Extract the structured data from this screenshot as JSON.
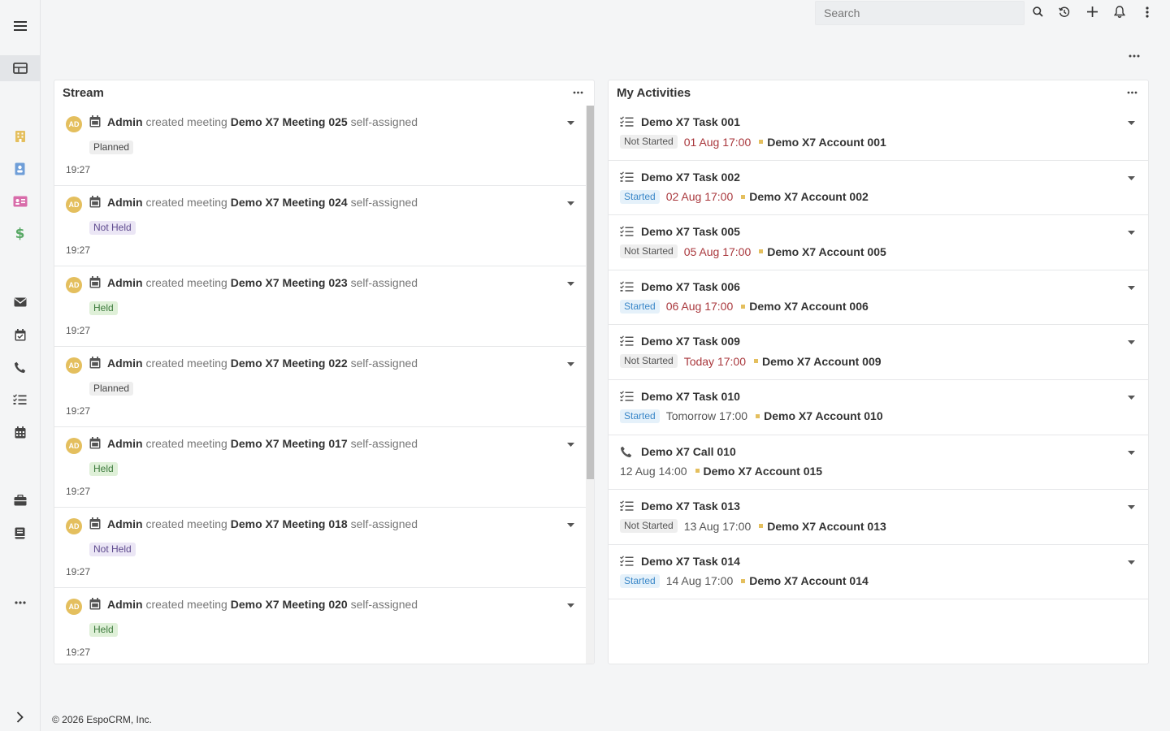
{
  "topbar": {
    "search_placeholder": "Search",
    "icons": [
      "search-icon",
      "history-icon",
      "plus-icon",
      "bell-icon",
      "kebab-icon"
    ]
  },
  "sidebar": {
    "items": [
      "menu-icon",
      "dashboard-icon",
      "accounts-icon",
      "contacts-icon",
      "leads-icon",
      "opportunities-icon",
      "email-icon",
      "meetings-icon",
      "calls-icon",
      "tasks-icon",
      "calendar-icon",
      "cases-icon",
      "knowledge-base-icon",
      "more-icon",
      "expand-icon"
    ]
  },
  "colors": {
    "accent": "#e4bf5e",
    "planned_bg": "#eeeeee",
    "not_held_bg": "#ebe6f5",
    "held_bg": "#dff0d8",
    "started_bg": "#e5f1fa",
    "overdue": "#a9373c"
  },
  "stream": {
    "title": "Stream",
    "items": [
      {
        "avatar": "AD",
        "user": "Admin",
        "action": "created meeting",
        "subject": "Demo X7 Meeting 025",
        "suffix": "self-assigned",
        "status": "Planned",
        "status_type": "planned",
        "time": "19:27"
      },
      {
        "avatar": "AD",
        "user": "Admin",
        "action": "created meeting",
        "subject": "Demo X7 Meeting 024",
        "suffix": "self-assigned",
        "status": "Not Held",
        "status_type": "notheld",
        "time": "19:27"
      },
      {
        "avatar": "AD",
        "user": "Admin",
        "action": "created meeting",
        "subject": "Demo X7 Meeting 023",
        "suffix": "self-assigned",
        "status": "Held",
        "status_type": "held",
        "time": "19:27"
      },
      {
        "avatar": "AD",
        "user": "Admin",
        "action": "created meeting",
        "subject": "Demo X7 Meeting 022",
        "suffix": "self-assigned",
        "status": "Planned",
        "status_type": "planned",
        "time": "19:27"
      },
      {
        "avatar": "AD",
        "user": "Admin",
        "action": "created meeting",
        "subject": "Demo X7 Meeting 017",
        "suffix": "self-assigned",
        "status": "Held",
        "status_type": "held",
        "time": "19:27"
      },
      {
        "avatar": "AD",
        "user": "Admin",
        "action": "created meeting",
        "subject": "Demo X7 Meeting 018",
        "suffix": "self-assigned",
        "status": "Not Held",
        "status_type": "notheld",
        "time": "19:27"
      },
      {
        "avatar": "AD",
        "user": "Admin",
        "action": "created meeting",
        "subject": "Demo X7 Meeting 020",
        "suffix": "self-assigned",
        "status": "Held",
        "status_type": "held",
        "time": "19:27"
      }
    ]
  },
  "activities": {
    "title": "My Activities",
    "items": [
      {
        "type": "task",
        "name": "Demo X7 Task 001",
        "status": "Not Started",
        "status_type": "notstarted",
        "date": "01 Aug 17:00",
        "overdue": true,
        "account": "Demo X7 Account 001"
      },
      {
        "type": "task",
        "name": "Demo X7 Task 002",
        "status": "Started",
        "status_type": "started",
        "date": "02 Aug 17:00",
        "overdue": true,
        "account": "Demo X7 Account 002"
      },
      {
        "type": "task",
        "name": "Demo X7 Task 005",
        "status": "Not Started",
        "status_type": "notstarted",
        "date": "05 Aug 17:00",
        "overdue": true,
        "account": "Demo X7 Account 005"
      },
      {
        "type": "task",
        "name": "Demo X7 Task 006",
        "status": "Started",
        "status_type": "started",
        "date": "06 Aug 17:00",
        "overdue": true,
        "account": "Demo X7 Account 006"
      },
      {
        "type": "task",
        "name": "Demo X7 Task 009",
        "status": "Not Started",
        "status_type": "notstarted",
        "date": "Today 17:00",
        "overdue": true,
        "account": "Demo X7 Account 009"
      },
      {
        "type": "task",
        "name": "Demo X7 Task 010",
        "status": "Started",
        "status_type": "started",
        "date": "Tomorrow 17:00",
        "overdue": false,
        "account": "Demo X7 Account 010"
      },
      {
        "type": "call",
        "name": "Demo X7 Call 010",
        "status": "",
        "status_type": "",
        "date": "12 Aug 14:00",
        "overdue": false,
        "account": "Demo X7 Account 015"
      },
      {
        "type": "task",
        "name": "Demo X7 Task 013",
        "status": "Not Started",
        "status_type": "notstarted",
        "date": "13 Aug 17:00",
        "overdue": false,
        "account": "Demo X7 Account 013"
      },
      {
        "type": "task",
        "name": "Demo X7 Task 014",
        "status": "Started",
        "status_type": "started",
        "date": "14 Aug 17:00",
        "overdue": false,
        "account": "Demo X7 Account 014"
      }
    ]
  },
  "footer": {
    "text": "© 2026 EspoCRM, Inc."
  }
}
